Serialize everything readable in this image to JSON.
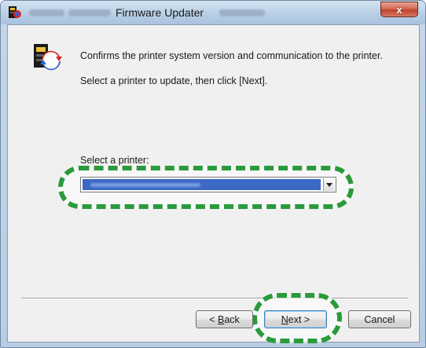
{
  "window": {
    "title": "Firmware Updater",
    "close_glyph": "x"
  },
  "main": {
    "description_line1": "Confirms the printer system version and communication to the printer.",
    "description_line2": "Select a printer to update, then click [Next].",
    "select_label": "Select a printer:"
  },
  "buttons": {
    "back_accesskey": "B",
    "back_rest": "ack",
    "back_prefix": "< ",
    "next_accesskey": "N",
    "next_rest": "ext >",
    "cancel": "Cancel"
  },
  "icons": {
    "title": "firmware-updater-app-icon",
    "app": "firmware-updater-app-icon",
    "combo": "chevron-down-icon",
    "close": "close-icon"
  },
  "colors": {
    "highlight": "#2a9a3b",
    "selection": "#3c69c5",
    "close_button": "#c0422b"
  }
}
